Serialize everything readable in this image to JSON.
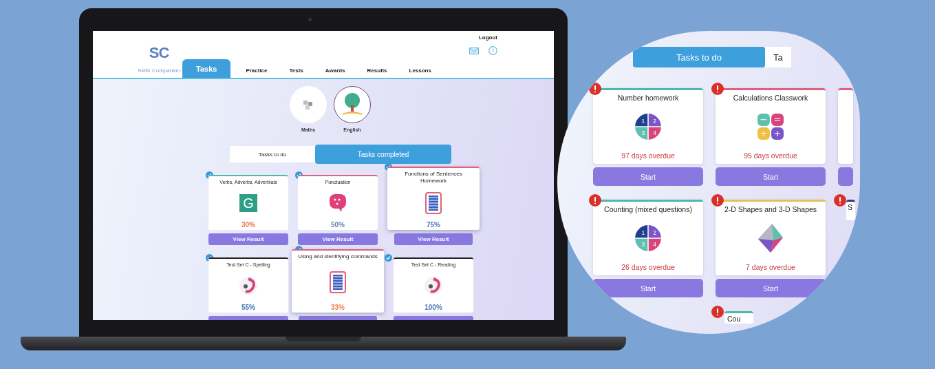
{
  "app": {
    "logo": "SC",
    "tagline": "Skills Companion",
    "logout": "Logout",
    "nav": [
      {
        "label": "Tasks",
        "selected": true
      },
      {
        "label": "Practice",
        "selected": false
      },
      {
        "label": "Tests",
        "selected": false
      },
      {
        "label": "Awards",
        "selected": false
      },
      {
        "label": "Results",
        "selected": false
      },
      {
        "label": "Lessons",
        "selected": false
      }
    ],
    "subjects": [
      {
        "label": "Maths",
        "kind": "cubes",
        "selected": false
      },
      {
        "label": "English",
        "kind": "tree",
        "selected": true
      }
    ],
    "task_tabs": [
      {
        "label": "Tasks to do",
        "selected": false
      },
      {
        "label": "Tasks completed",
        "selected": true
      }
    ],
    "cards": [
      {
        "title": "Verbs, Adverbs, Adverbials",
        "kind": "letter",
        "glyph": "G",
        "score": {
          "text": "30%",
          "color": "#e8744f"
        },
        "color": "#4fb8a8",
        "highlighted": false,
        "button": "View Result"
      },
      {
        "title": "Punctuation",
        "kind": "bubble",
        "score": {
          "text": "50%",
          "color": "#6a7fb0"
        },
        "color": "#e0607e",
        "highlighted": false,
        "button": "View Result"
      },
      {
        "title": "Functions of Sentences Homework",
        "kind": "document",
        "score": {
          "text": "75%",
          "color": "#4a78b5"
        },
        "color": "#e0607e",
        "highlighted": true,
        "button": "View Result"
      },
      {
        "title": "Test Set C - Spelling",
        "kind": "swirl",
        "score": {
          "text": "55%",
          "color": "#4a78b5"
        },
        "color": "#222222",
        "highlighted": false
      },
      {
        "title": "Using and identifying commands",
        "kind": "document",
        "score": {
          "text": "33%",
          "color": "#e8844f"
        },
        "color": "#e0607e",
        "highlighted": true
      },
      {
        "title": "Test Set C - Reading",
        "kind": "swirl",
        "score": {
          "text": "100%",
          "color": "#4a78b5"
        },
        "color": "#222222",
        "highlighted": false
      }
    ]
  },
  "magnified": {
    "tabs": [
      {
        "label": "Tasks to do",
        "selected": true
      },
      {
        "label": "Ta",
        "selected": false
      }
    ],
    "cards": [
      {
        "title": "Number homework",
        "kind": "quadrants",
        "digits": [
          "1",
          "2",
          "3",
          "4"
        ],
        "status": "97 days overdue",
        "color": "#4fb8a8",
        "alert": true,
        "button": "Start"
      },
      {
        "title": "Calculations Classwork",
        "kind": "operators",
        "symbols": [
          "−",
          "=",
          "÷",
          "+"
        ],
        "status": "95 days overdue",
        "color": "#e0607e",
        "alert": true,
        "button": "Start"
      },
      {
        "kind": "stub",
        "color": "#e0607e",
        "alert": false
      },
      {
        "title": "Counting (mixed questions)",
        "kind": "quadrants",
        "digits": [
          "1",
          "2",
          "3",
          "4"
        ],
        "status": "26 days overdue",
        "color": "#4fb8a8",
        "alert": true,
        "button": "Start"
      },
      {
        "title": "2-D Shapes and 3-D Shapes",
        "kind": "octahedron",
        "status": "7 days overdue",
        "color": "#e8c05a",
        "alert": true,
        "button": "Start"
      },
      {
        "title": "S",
        "kind": "partial",
        "color": "#2a3a7a",
        "alert": true
      },
      {
        "title": "Cou",
        "kind": "partial",
        "color": "#4fb8a8",
        "alert": true
      }
    ]
  }
}
